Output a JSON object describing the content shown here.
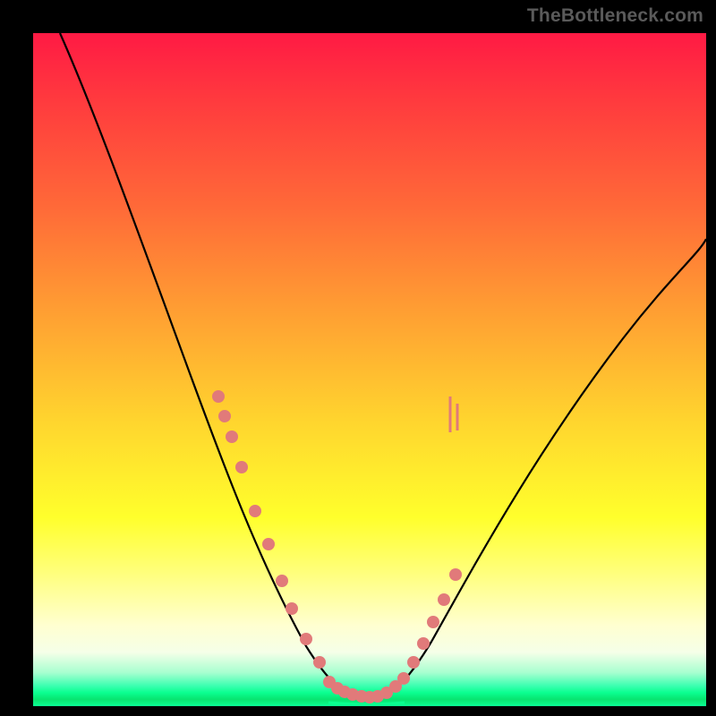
{
  "watermark": "TheBottleneck.com",
  "colors": {
    "frame": "#000000",
    "gradient_top": "#ff1a44",
    "gradient_mid": "#ffff2c",
    "gradient_bottom": "#0aff90",
    "curve": "#000000",
    "beads": "#e17a7a"
  },
  "chart_data": {
    "type": "line",
    "title": "",
    "xlabel": "",
    "ylabel": "",
    "xlim": [
      0,
      100
    ],
    "ylim": [
      0,
      100
    ],
    "series": [
      {
        "name": "bottleneck-curve",
        "x": [
          4,
          8,
          12,
          16,
          20,
          24,
          27,
          30,
          32,
          34,
          36,
          38,
          40,
          41.5,
          43,
          44,
          45,
          46,
          48,
          50,
          52,
          54,
          56,
          58,
          60,
          64,
          68,
          72,
          78,
          85,
          92,
          100
        ],
        "y": [
          100,
          93,
          85,
          76,
          67,
          57,
          48,
          40,
          34,
          28,
          23,
          18,
          13.5,
          10,
          7,
          5,
          3.5,
          2.5,
          1.5,
          1.2,
          1.7,
          3,
          5.5,
          8.5,
          12,
          19,
          26,
          33,
          42,
          51,
          58,
          65
        ]
      }
    ],
    "beads_left": [
      {
        "x": 27.5,
        "y": 46
      },
      {
        "x": 28.5,
        "y": 43
      },
      {
        "x": 29.5,
        "y": 40
      },
      {
        "x": 31.0,
        "y": 35.5
      },
      {
        "x": 33.0,
        "y": 29
      },
      {
        "x": 35.0,
        "y": 24
      },
      {
        "x": 37.0,
        "y": 18.5
      },
      {
        "x": 38.5,
        "y": 14.5
      },
      {
        "x": 40.5,
        "y": 10
      },
      {
        "x": 42.5,
        "y": 6.5
      }
    ],
    "beads_bottom": [
      {
        "x": 44.0,
        "y": 3.6
      },
      {
        "x": 45.2,
        "y": 2.7
      },
      {
        "x": 46.3,
        "y": 2.1
      },
      {
        "x": 47.5,
        "y": 1.7
      },
      {
        "x": 48.8,
        "y": 1.4
      },
      {
        "x": 50.0,
        "y": 1.3
      },
      {
        "x": 51.2,
        "y": 1.5
      },
      {
        "x": 52.5,
        "y": 2.0
      },
      {
        "x": 53.8,
        "y": 2.9
      },
      {
        "x": 55.0,
        "y": 4.1
      }
    ],
    "beads_right": [
      {
        "x": 56.5,
        "y": 6.5
      },
      {
        "x": 58.0,
        "y": 9.3
      },
      {
        "x": 59.5,
        "y": 12.5
      },
      {
        "x": 61.0,
        "y": 15.8
      },
      {
        "x": 62.7,
        "y": 19.5
      }
    ],
    "ticks_right": [
      {
        "x": 62.0,
        "y1": 40,
        "y2": 46
      },
      {
        "x": 63.0,
        "y1": 39,
        "y2": 43
      }
    ]
  }
}
